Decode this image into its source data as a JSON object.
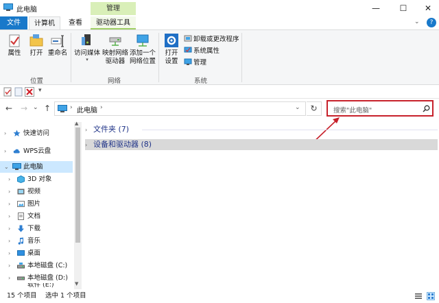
{
  "window": {
    "title": "此电脑",
    "context_tab": "管理",
    "minimize_glyph": "—",
    "maximize_glyph": "☐",
    "close_glyph": "✕"
  },
  "tabs": {
    "file": "文件",
    "computer": "计算机",
    "view": "查看",
    "drive_tools": "驱动器工具",
    "collapse_glyph": "⌄",
    "help_glyph": "?"
  },
  "ribbon": {
    "location": {
      "label": "位置",
      "properties": "属性",
      "open": "打开",
      "rename": "重命名"
    },
    "network": {
      "label": "网络",
      "access_media": "访问媒体",
      "map_drive_line1": "映射网络",
      "map_drive_line2": "驱动器",
      "add_location_line1": "添加一个",
      "add_location_line2": "网络位置"
    },
    "system": {
      "label": "系统",
      "open_settings_line1": "打开",
      "open_settings_line2": "设置",
      "uninstall": "卸载或更改程序",
      "sys_properties": "系统属性",
      "manage": "管理"
    }
  },
  "qat": {
    "dropdown_glyph": "▾"
  },
  "address": {
    "back": "←",
    "forward": "→",
    "recent": "⌄",
    "up": "↑",
    "path": "此电脑",
    "chevron": "›",
    "dropdown": "⌄",
    "refresh": "↻",
    "search_placeholder": "搜索\"此电脑\""
  },
  "nav": {
    "items": [
      {
        "label": "快速访问",
        "icon": "star-icon"
      },
      {
        "label": "WPS云盘",
        "icon": "cloud-icon"
      },
      {
        "label": "此电脑",
        "icon": "computer-icon"
      },
      {
        "label": "3D 对象",
        "icon": "cube-icon"
      },
      {
        "label": "视频",
        "icon": "video-icon"
      },
      {
        "label": "图片",
        "icon": "picture-icon"
      },
      {
        "label": "文档",
        "icon": "document-icon"
      },
      {
        "label": "下载",
        "icon": "download-icon"
      },
      {
        "label": "音乐",
        "icon": "music-icon"
      },
      {
        "label": "桌面",
        "icon": "desktop-icon"
      },
      {
        "label": "本地磁盘 (C:)",
        "icon": "drive-icon"
      },
      {
        "label": "本地磁盘 (D:)",
        "icon": "drive-icon"
      },
      {
        "label": "软件 (E:)",
        "icon": "drive-icon"
      }
    ],
    "collapsed_glyph": "›",
    "expanded_glyph": "⌄",
    "scroll_up": "▲",
    "scroll_down": "▼"
  },
  "content": {
    "groups": [
      {
        "label": "文件夹 (7)"
      },
      {
        "label": "设备和驱动器 (8)"
      }
    ],
    "group_chevron": "›"
  },
  "status": {
    "count": "15 个项目",
    "selected": "选中 1 个项目"
  },
  "colors": {
    "accent": "#1979ca",
    "manage_tab": "#d9efb8",
    "highlight_box": "#c7202a",
    "selection": "#cce8ff"
  }
}
